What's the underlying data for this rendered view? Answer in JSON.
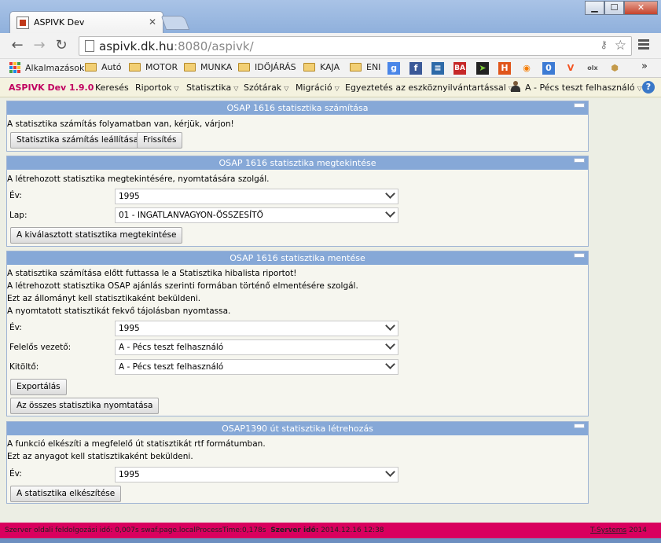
{
  "browser": {
    "tab_title": "ASPIVK Dev",
    "url_host": "aspivk.dk.hu",
    "url_rest": ":8080/aspivk/",
    "bookmarks": {
      "apps": "Alkalmazások",
      "folders": [
        "Autó",
        "MOTOR",
        "MUNKA",
        "IDŐJÁRÁS",
        "KAJA",
        "ENI"
      ],
      "more": "»"
    }
  },
  "nav": {
    "brand": "ASPIVK Dev 1.9.0",
    "search": "Keresés",
    "reports": "Riportok",
    "statistics": "Statisztika",
    "dictionaries": "Szótárak",
    "migration": "Migráció",
    "reconcile": "Egyeztetés az eszköznyilvántartással",
    "user": "A - Pécs teszt felhasználó",
    "help": "?"
  },
  "panel1": {
    "title": "OSAP 1616 statisztika számítása",
    "text": "A statisztika számítás folyamatban van, kérjük, várjon!",
    "stop_button": "Statisztika számítás leállítása",
    "refresh_button": "Frissítés"
  },
  "panel2": {
    "title": "OSAP 1616 statisztika megtekintése",
    "text": "A létrehozott statisztika megtekintésére, nyomtatására szolgál.",
    "year_label": "Év:",
    "year_value": "1995",
    "sheet_label": "Lap:",
    "sheet_value": "01 - INGATLANVAGYON-ÖSSZESÍTŐ",
    "view_button": "A kiválasztott statisztika megtekintése"
  },
  "panel3": {
    "title": "OSAP 1616 statisztika mentése",
    "lines": [
      "A statisztika számítása előtt futtassa le a Statisztika hibalista riportot!",
      "A létrehozott statisztika OSAP ajánlás szerinti formában történő elmentésére szolgál.",
      "Ezt az állományt kell statisztikaként beküldeni.",
      "A nyomtatott statisztikát fekvő tájolásban nyomtassa."
    ],
    "year_label": "Év:",
    "year_value": "1995",
    "manager_label": "Felelős vezető:",
    "manager_value": "A - Pécs teszt felhasználó",
    "filler_label": "Kitöltő:",
    "filler_value": "A - Pécs teszt felhasználó",
    "export_button": "Exportálás",
    "print_button": "Az összes statisztika nyomtatása"
  },
  "panel4": {
    "title": "OSAP1390 út statisztika létrehozás",
    "lines": [
      "A funkció elkészíti a megfelelő út statisztikát rtf formátumban.",
      "Ezt az anyagot kell statisztikaként beküldeni."
    ],
    "year_label": "Év:",
    "year_value": "1995",
    "create_button": "A statisztika elkészítése"
  },
  "footer": {
    "left_text": "Szerver oldali feldolgozási idő: 0,007s swaf.page.localProcessTime:0,178s",
    "server_time_label": "Szerver idő:",
    "server_time_value": "2014.12.16 12:38",
    "company": "T-Systems",
    "year": "2014"
  }
}
